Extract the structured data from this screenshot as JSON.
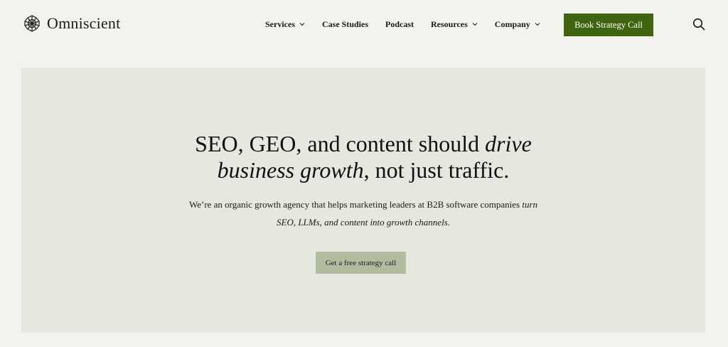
{
  "brand": {
    "name": "Omniscient",
    "icon": "logo-knot-icon"
  },
  "nav": {
    "items": [
      {
        "label": "Services",
        "has_dropdown": true
      },
      {
        "label": "Case Studies",
        "has_dropdown": false
      },
      {
        "label": "Podcast",
        "has_dropdown": false
      },
      {
        "label": "Resources",
        "has_dropdown": true
      },
      {
        "label": "Company",
        "has_dropdown": true
      }
    ],
    "cta_label": "Book Strategy Call",
    "search_icon": "search-icon"
  },
  "hero": {
    "title_part1": "SEO, GEO, and content should ",
    "title_em1": "drive",
    "title_em2": "business growth",
    "title_part2": ", not just traffic.",
    "subtitle_part1": "We’re an organic growth agency that helps marketing leaders at B2B software companies ",
    "subtitle_em1": "turn",
    "subtitle_em2": "SEO, LLMs, and content into growth channels",
    "subtitle_part2": ".",
    "cta_label": "Get a free strategy call"
  },
  "colors": {
    "page_bg": "#f2f3ee",
    "hero_bg": "#e4e8de",
    "primary_button": "#3f640f",
    "secondary_button": "#b3bc9f"
  }
}
